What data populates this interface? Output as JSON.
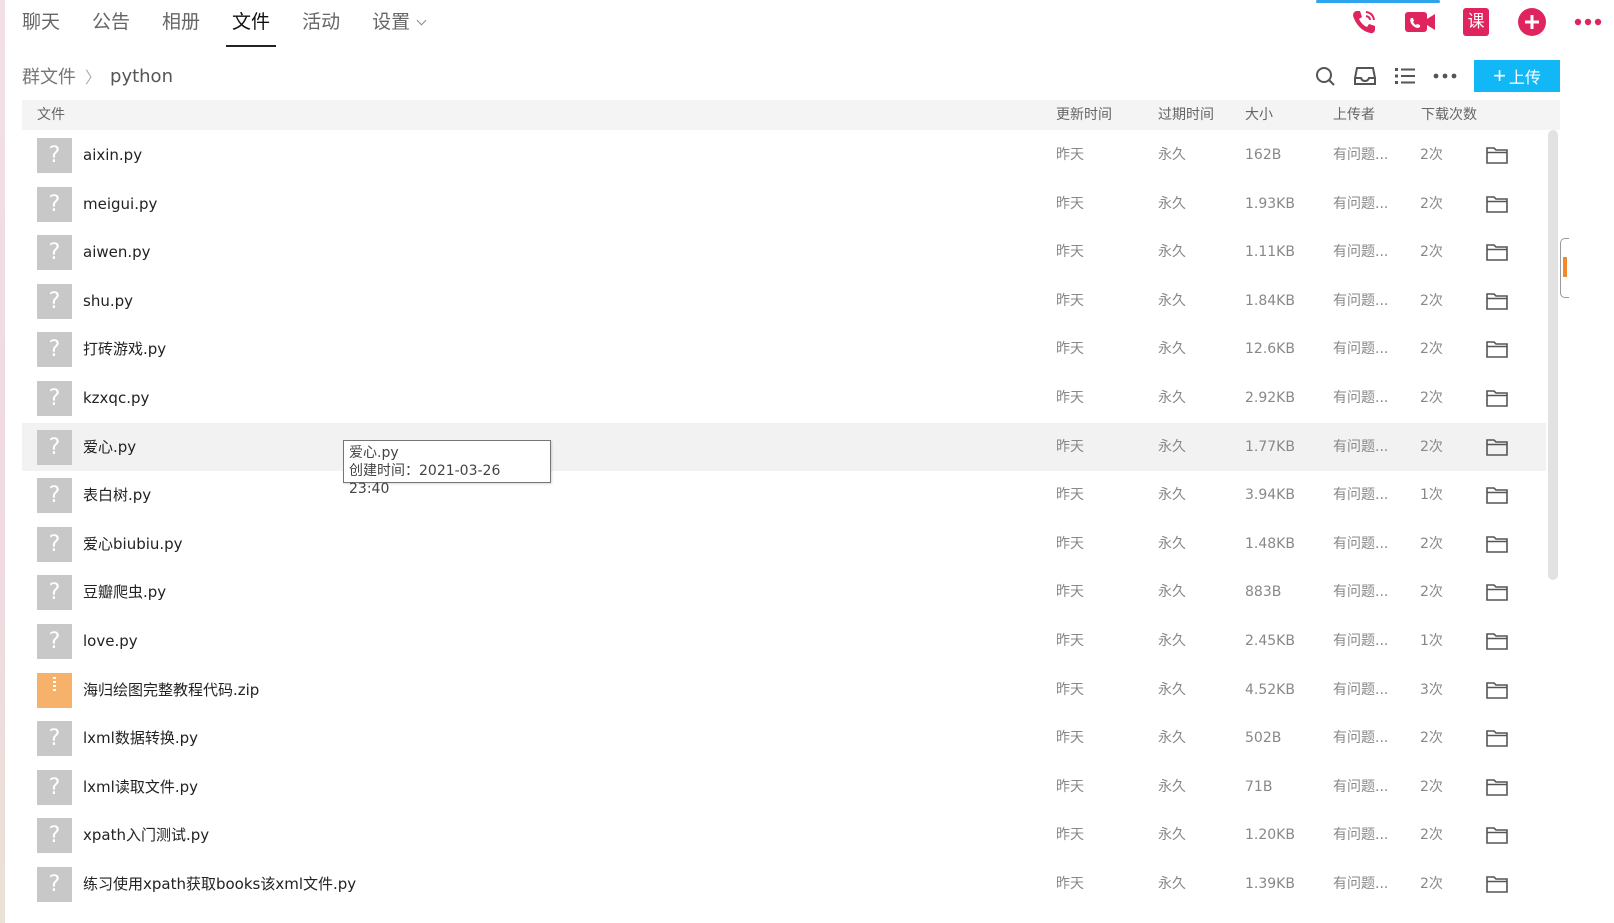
{
  "nav": {
    "tabs": [
      {
        "label": "聊天"
      },
      {
        "label": "公告"
      },
      {
        "label": "相册"
      },
      {
        "label": "文件"
      },
      {
        "label": "活动"
      },
      {
        "label": "设置"
      }
    ],
    "active_tab": "文件",
    "top_icons": [
      "phone-icon",
      "video-call-icon",
      "class-icon",
      "add-icon",
      "more-icon"
    ],
    "class_icon_text": "课",
    "accent_color": "#e0245e"
  },
  "breadcrumb": {
    "root": "群文件",
    "separator": "〉",
    "current": "python"
  },
  "toolbar": {
    "icons": [
      "search-icon",
      "inbox-icon",
      "list-view-icon",
      "more-icon"
    ],
    "upload_plus": "+",
    "upload_label": "上传",
    "upload_color": "#12b7f5"
  },
  "table": {
    "headers": {
      "file": "文件",
      "updated": "更新时间",
      "expires": "过期时间",
      "size": "大小",
      "uploader": "上传者",
      "downloads": "下载次数"
    },
    "rows": [
      {
        "icon": "?",
        "type": "unknown",
        "name": "aixin.py",
        "updated": "昨天",
        "expires": "永久",
        "size": "162B",
        "uploader": "有问题...",
        "downloads": "2次"
      },
      {
        "icon": "?",
        "type": "unknown",
        "name": "meigui.py",
        "updated": "昨天",
        "expires": "永久",
        "size": "1.93KB",
        "uploader": "有问题...",
        "downloads": "2次"
      },
      {
        "icon": "?",
        "type": "unknown",
        "name": "aiwen.py",
        "updated": "昨天",
        "expires": "永久",
        "size": "1.11KB",
        "uploader": "有问题...",
        "downloads": "2次"
      },
      {
        "icon": "?",
        "type": "unknown",
        "name": "shu.py",
        "updated": "昨天",
        "expires": "永久",
        "size": "1.84KB",
        "uploader": "有问题...",
        "downloads": "2次"
      },
      {
        "icon": "?",
        "type": "unknown",
        "name": "打砖游戏.py",
        "updated": "昨天",
        "expires": "永久",
        "size": "12.6KB",
        "uploader": "有问题...",
        "downloads": "2次"
      },
      {
        "icon": "?",
        "type": "unknown",
        "name": "kzxqc.py",
        "updated": "昨天",
        "expires": "永久",
        "size": "2.92KB",
        "uploader": "有问题...",
        "downloads": "2次"
      },
      {
        "icon": "?",
        "type": "unknown",
        "name": "爱心.py",
        "updated": "昨天",
        "expires": "永久",
        "size": "1.77KB",
        "uploader": "有问题...",
        "downloads": "2次",
        "hover": true
      },
      {
        "icon": "?",
        "type": "unknown",
        "name": "表白树.py",
        "updated": "昨天",
        "expires": "永久",
        "size": "3.94KB",
        "uploader": "有问题...",
        "downloads": "1次"
      },
      {
        "icon": "?",
        "type": "unknown",
        "name": "爱心biubiu.py",
        "updated": "昨天",
        "expires": "永久",
        "size": "1.48KB",
        "uploader": "有问题...",
        "downloads": "2次"
      },
      {
        "icon": "?",
        "type": "unknown",
        "name": "豆瓣爬虫.py",
        "updated": "昨天",
        "expires": "永久",
        "size": "883B",
        "uploader": "有问题...",
        "downloads": "2次"
      },
      {
        "icon": "?",
        "type": "unknown",
        "name": "love.py",
        "updated": "昨天",
        "expires": "永久",
        "size": "2.45KB",
        "uploader": "有问题...",
        "downloads": "1次"
      },
      {
        "icon": "",
        "type": "zip",
        "name": "海归绘图完整教程代码.zip",
        "updated": "昨天",
        "expires": "永久",
        "size": "4.52KB",
        "uploader": "有问题...",
        "downloads": "3次"
      },
      {
        "icon": "?",
        "type": "unknown",
        "name": "lxml数据转换.py",
        "updated": "昨天",
        "expires": "永久",
        "size": "502B",
        "uploader": "有问题...",
        "downloads": "2次"
      },
      {
        "icon": "?",
        "type": "unknown",
        "name": "lxml读取文件.py",
        "updated": "昨天",
        "expires": "永久",
        "size": "71B",
        "uploader": "有问题...",
        "downloads": "2次"
      },
      {
        "icon": "?",
        "type": "unknown",
        "name": "xpath入门测试.py",
        "updated": "昨天",
        "expires": "永久",
        "size": "1.20KB",
        "uploader": "有问题...",
        "downloads": "2次"
      },
      {
        "icon": "?",
        "type": "unknown",
        "name": "练习使用xpath获取books该xml文件.py",
        "updated": "昨天",
        "expires": "永久",
        "size": "1.39KB",
        "uploader": "有问题...",
        "downloads": "2次"
      }
    ]
  },
  "tooltip": {
    "title": "爱心.py",
    "created": "创建时间：2021-03-26 23:40"
  }
}
